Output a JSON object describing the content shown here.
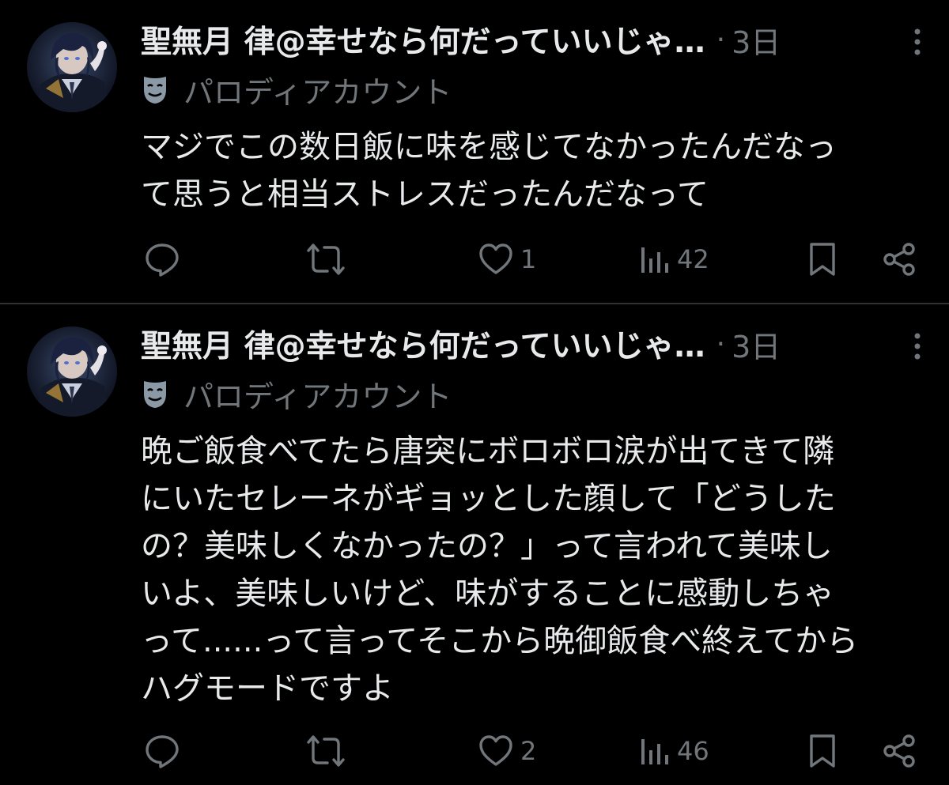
{
  "colors": {
    "background": "#000000",
    "text_primary": "#e7e9ea",
    "text_secondary": "#71767b",
    "divider": "#2f3336"
  },
  "posts": [
    {
      "display_name": "聖無月 律@幸せなら何だっていいじゃ…",
      "separator": "·",
      "time": "3日",
      "account_label_icon": "theater-mask-icon",
      "account_label": "パロディアカウント",
      "text": "マジでこの数日飯に味を感じてなかったんだなっ\nて思うと相当ストレスだったんだなって",
      "actions": {
        "reply_count": "",
        "retweet_count": "",
        "like_count": "1",
        "view_count": "42"
      }
    },
    {
      "display_name": "聖無月 律@幸せなら何だっていいじゃ…",
      "separator": "·",
      "time": "3日",
      "account_label_icon": "theater-mask-icon",
      "account_label": "パロディアカウント",
      "text": "晩ご飯食べてたら唐突にボロボロ涙が出てきて隣\nにいたセレーネがギョッとした顔して「どうした\nの？美味しくなかったの？」って言われて美味し\nいよ、美味しいけど、味がすることに感動しちゃ\nって......って言ってそこから晩御飯食べ終えてから\nハグモードですよ",
      "actions": {
        "reply_count": "",
        "retweet_count": "",
        "like_count": "2",
        "view_count": "46"
      }
    }
  ]
}
